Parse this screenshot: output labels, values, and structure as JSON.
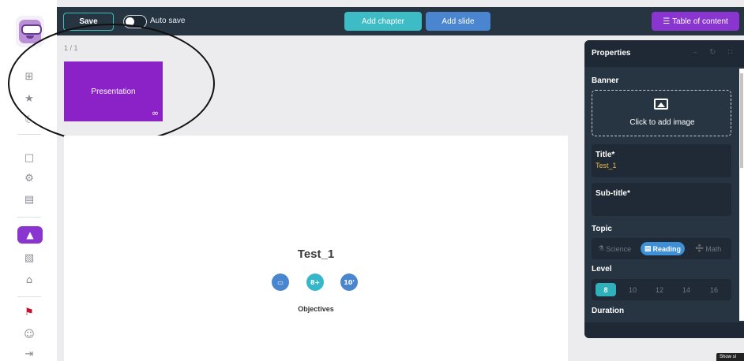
{
  "sidebar": {
    "logo": "owl-mascot-logo",
    "items": [
      {
        "name": "grid-icon",
        "glyph": "⊞"
      },
      {
        "name": "star-icon",
        "glyph": "★"
      },
      {
        "name": "moon-icon",
        "glyph": "☾"
      },
      {
        "name": "document-icon",
        "glyph": "□"
      },
      {
        "name": "settings-icon",
        "glyph": "⚙"
      },
      {
        "name": "media-icon",
        "glyph": "▤"
      },
      {
        "name": "graduation-cap-icon",
        "glyph": "▲"
      },
      {
        "name": "edit-icon",
        "glyph": "▧"
      },
      {
        "name": "robot-icon",
        "glyph": "⌂"
      },
      {
        "name": "language-flag-icon",
        "glyph": "⚑"
      },
      {
        "name": "user-settings-icon",
        "glyph": "☺"
      },
      {
        "name": "logout-icon",
        "glyph": "⇥"
      }
    ]
  },
  "toolbar": {
    "save_label": "Save",
    "autosave_label": "Auto save",
    "add_chapter_label": "Add chapter",
    "add_slide_label": "Add slide",
    "toc_label": "Table of content",
    "toc_icon": "☰"
  },
  "slides": {
    "count": "1 / 1",
    "thumb_label": "Presentation",
    "thumb_icon": "∞"
  },
  "canvas": {
    "title": "Test_1",
    "badges": [
      {
        "name": "topic-badge",
        "text": "▭",
        "color": "#4a86cf"
      },
      {
        "name": "level-badge",
        "text": "8+",
        "color": "#35b7c9"
      },
      {
        "name": "duration-badge",
        "text": "10'",
        "color": "#4a86cf"
      }
    ],
    "objectives_label": "Objectives"
  },
  "properties": {
    "title": "Properties",
    "controls": "– ↻ ∷",
    "banner_label": "Banner",
    "banner_placeholder": "Click to add image",
    "title_field_label": "Title*",
    "title_field_value": "Test_1",
    "subtitle_field_label": "Sub-title*",
    "topic_label": "Topic",
    "topics": [
      {
        "label": "Science",
        "icon": "⚗",
        "active": false
      },
      {
        "label": "Reading",
        "icon": "▤",
        "active": true
      },
      {
        "label": "Math",
        "icon": "➗",
        "active": false
      }
    ],
    "level_label": "Level",
    "levels": [
      "8",
      "10",
      "12",
      "14",
      "16"
    ],
    "selected_level": "8",
    "duration_label": "Duration"
  },
  "tooltip": "Show sl"
}
